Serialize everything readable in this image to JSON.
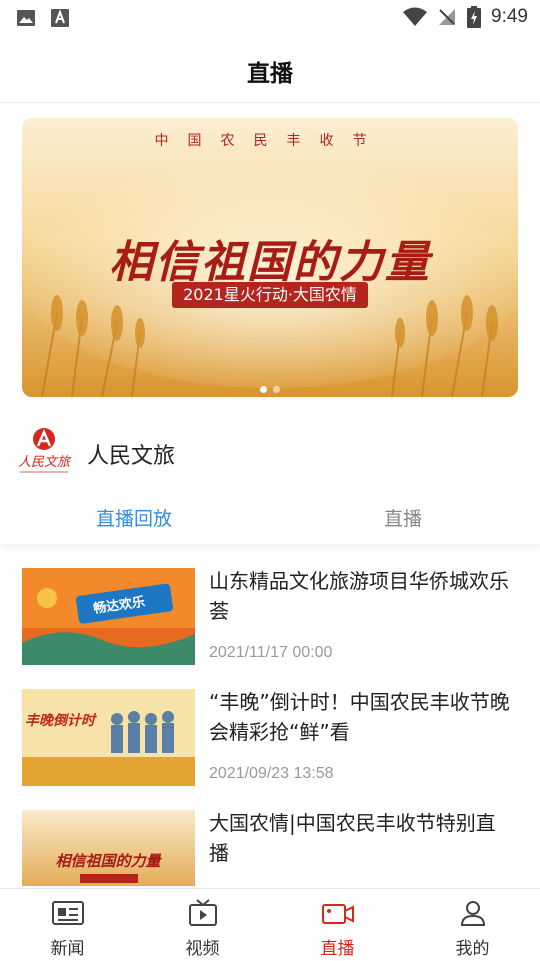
{
  "status_bar": {
    "time": "9:49"
  },
  "header": {
    "title": "直播"
  },
  "banner": {
    "top_text": "中国农民丰收节",
    "headline": "相信祖国的力量",
    "subtitle": "2021星火行动·大国农情",
    "dot_count": 2,
    "active_dot": 1
  },
  "channel": {
    "name": "人民文旅",
    "logo_text": "人民文旅"
  },
  "tabs": [
    {
      "label": "直播回放",
      "active": true
    },
    {
      "label": "直播",
      "active": false
    }
  ],
  "list": [
    {
      "title": "山东精品文化旅游项目华侨城欢乐荟",
      "time": "2021/11/17 00:00",
      "thumb_text": "畅达欢乐"
    },
    {
      "title": "“丰晚”倒计时！中国农民丰收节晚会精彩抢“鲜”看",
      "time": "2021/09/23 13:58",
      "thumb_text": "丰晚倒计时"
    },
    {
      "title": "大国农情|中国农民丰收节特别直播",
      "time": "",
      "thumb_text": "相信祖国的力量"
    }
  ],
  "bottom_nav": [
    {
      "label": "新闻",
      "icon": "news-icon",
      "active": false
    },
    {
      "label": "视频",
      "icon": "tv-icon",
      "active": false
    },
    {
      "label": "直播",
      "icon": "live-camera-icon",
      "active": true
    },
    {
      "label": "我的",
      "icon": "profile-icon",
      "active": false
    }
  ],
  "colors": {
    "accent": "#2f8ee5",
    "brand_red": "#d7261c",
    "wheat": "#e8b04a"
  }
}
